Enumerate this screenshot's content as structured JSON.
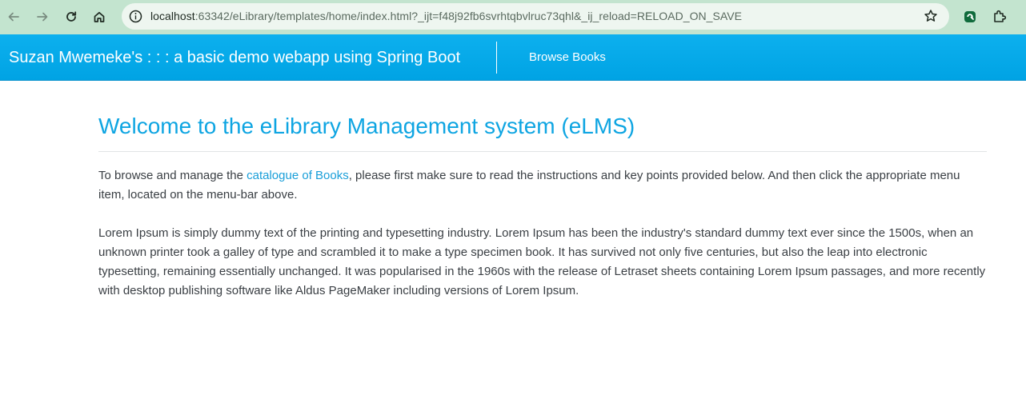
{
  "browser": {
    "url_host": "localhost",
    "url_rest": ":63342/eLibrary/templates/home/index.html?_ijt=f48j92fb6svrhtqbvlruc73qhl&_ij_reload=RELOAD_ON_SAVE",
    "icons": [
      "back-arrow-icon",
      "forward-arrow-icon",
      "reload-icon",
      "home-icon",
      "site-info-icon",
      "bookmark-star-icon",
      "extension-icon",
      "puzzle-icon"
    ]
  },
  "navbar": {
    "brand": "Suzan Mwemeke's : : : a basic demo webapp using Spring Boot",
    "links": [
      {
        "label": "Browse Books"
      }
    ]
  },
  "main": {
    "title": "Welcome to the eLibrary Management system (eLMS)",
    "intro_before": "To browse and manage the ",
    "intro_link": "catalogue of Books",
    "intro_after": ", please first make sure to read the instructions and key points provided below. And then click the appropriate menu item, located on the menu-bar above.",
    "lorem": "Lorem Ipsum is simply dummy text of the printing and typesetting industry. Lorem Ipsum has been the industry's standard dummy text ever since the 1500s, when an unknown printer took a galley of type and scrambled it to make a type specimen book. It has survived not only five centuries, but also the leap into electronic typesetting, remaining essentially unchanged. It was popularised in the 1960s with the release of Letraset sheets containing Lorem Ipsum passages, and more recently with desktop publishing software like Aldus PageMaker including versions of Lorem Ipsum."
  },
  "colors": {
    "navbar": "#00a3e4",
    "title": "#0ea5e2",
    "link": "#1a9fd9",
    "browser_chrome": "#c3e4cf"
  }
}
